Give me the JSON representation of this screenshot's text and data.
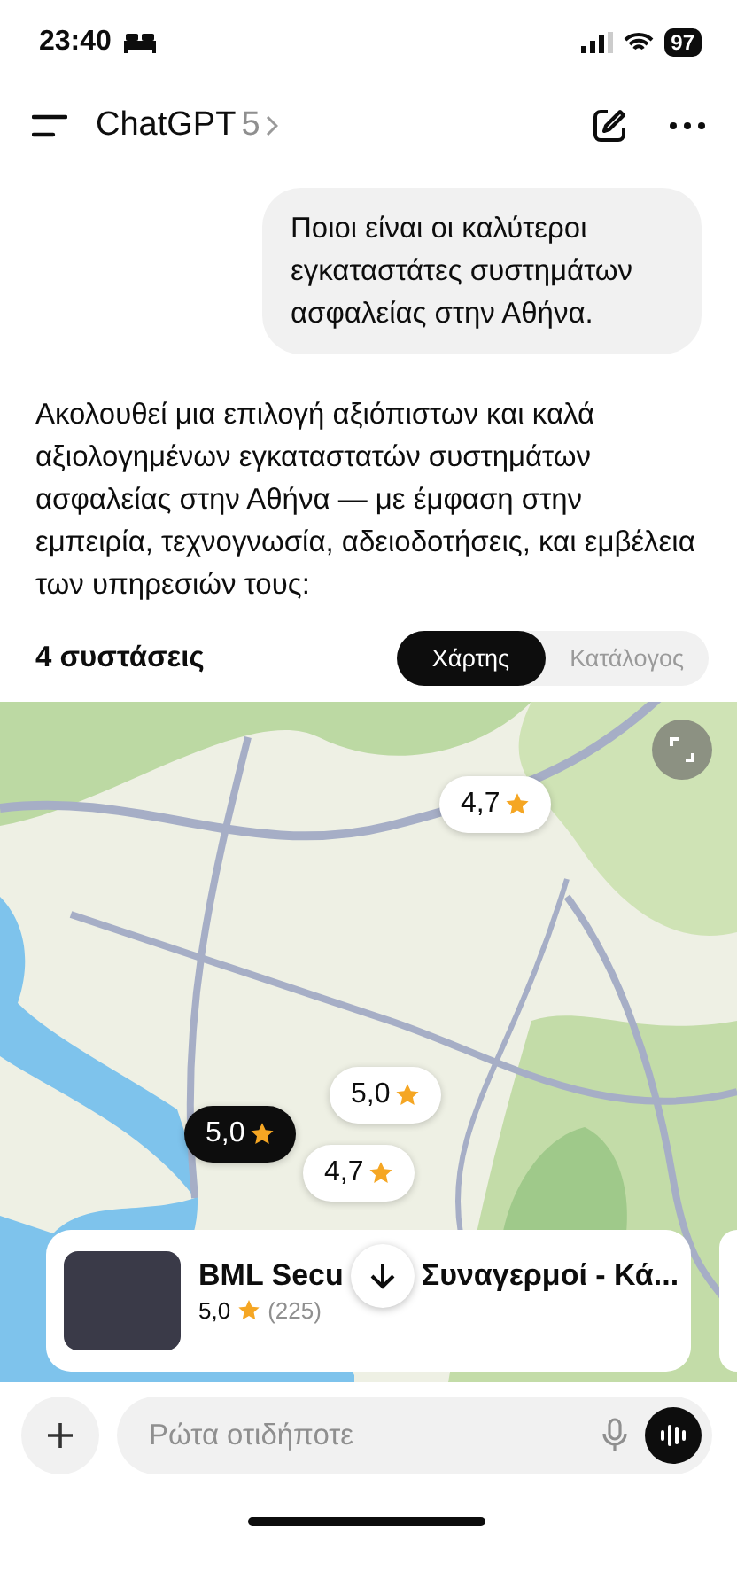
{
  "status_bar": {
    "time": "23:40",
    "battery": "97"
  },
  "header": {
    "title": "ChatGPT",
    "model": "5"
  },
  "user_message": "Ποιοι είναι οι καλύτεροι εγκαταστάτες συστημάτων ασφαλείας στην Αθήνα.",
  "assistant_message": "Ακολουθεί μια επιλογή αξιόπιστων και καλά αξιολογημένων εγκαταστατών συστημάτων ασφαλείας στην Αθήνα — με έμφαση στην εμπειρία, τεχνογνωσία, αδειοδοτήσεις, και εμβέλεια των υπηρεσιών τους:",
  "results": {
    "count_label": "4 συστάσεις",
    "tabs": [
      {
        "label": "Χάρτης",
        "selected": true
      },
      {
        "label": "Κατάλογος",
        "selected": false
      }
    ]
  },
  "map": {
    "pins": [
      {
        "rating": "4,7",
        "selected": false
      },
      {
        "rating": "5,0",
        "selected": false
      },
      {
        "rating": "5,0",
        "selected": true
      },
      {
        "rating": "4,7",
        "selected": false
      }
    ]
  },
  "place_card": {
    "title_start": "BML Secu",
    "title_end": "Συναγερμοί - Κά...",
    "rating": "5,0",
    "reviews": "(225)"
  },
  "composer": {
    "placeholder": "Ρώτα οτιδήποτε"
  }
}
